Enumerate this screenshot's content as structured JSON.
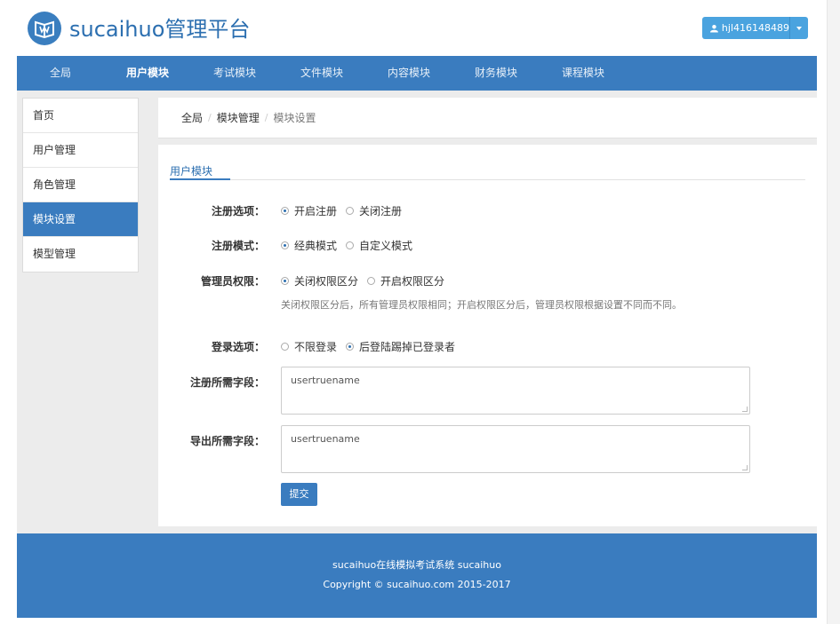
{
  "app": {
    "logo_text": "sucaihuo管理平台",
    "user_name": "hjl416148489"
  },
  "nav": {
    "items": [
      {
        "label": "全局",
        "active": false
      },
      {
        "label": "用户模块",
        "active": true
      },
      {
        "label": "考试模块",
        "active": false
      },
      {
        "label": "文件模块",
        "active": false
      },
      {
        "label": "内容模块",
        "active": false
      },
      {
        "label": "财务模块",
        "active": false
      },
      {
        "label": "课程模块",
        "active": false
      }
    ]
  },
  "sidebar": {
    "items": [
      {
        "label": "首页"
      },
      {
        "label": "用户管理"
      },
      {
        "label": "角色管理"
      },
      {
        "label": "模块设置"
      },
      {
        "label": "模型管理"
      }
    ]
  },
  "breadcrumb": [
    "全局",
    "模块管理",
    "模块设置"
  ],
  "section_title": "用户模块",
  "form": {
    "register_option": {
      "label": "注册选项：",
      "options": [
        "开启注册",
        "关闭注册"
      ],
      "selected": 0
    },
    "register_mode": {
      "label": "注册模式：",
      "options": [
        "经典模式",
        "自定义模式"
      ],
      "selected": 0
    },
    "admin_permission": {
      "label": "管理员权限：",
      "options": [
        "关闭权限区分",
        "开启权限区分"
      ],
      "selected": 0,
      "help": "关闭权限区分后，所有管理员权限相同；开启权限区分后，管理员权限根据设置不同而不同。"
    },
    "login_option": {
      "label": "登录选项：",
      "options": [
        "不限登录",
        "后登陆踢掉已登录者"
      ],
      "selected": 1
    },
    "register_fields": {
      "label": "注册所需字段：",
      "value": "usertruename"
    },
    "export_fields": {
      "label": "导出所需字段：",
      "value": "usertruename"
    },
    "submit_label": "提交"
  },
  "footer": {
    "line1": "sucaihuo在线模拟考试系统 sucaihuo",
    "line2": "Copyright © sucaihuo.com 2015-2017"
  },
  "colors": {
    "primary": "#3a7cbf",
    "user_button": "#4aa3df",
    "band": "#ececec"
  }
}
